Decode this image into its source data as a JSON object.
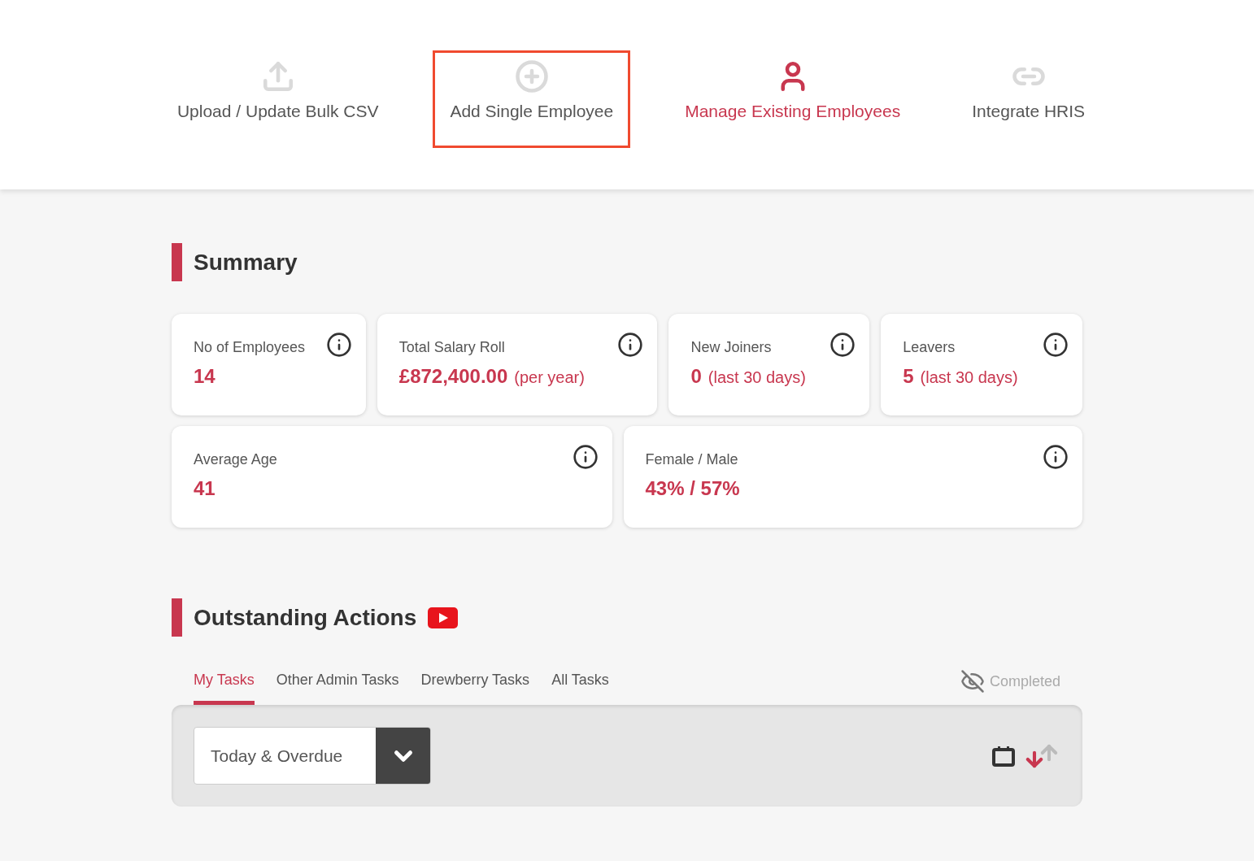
{
  "nav": [
    {
      "kind": "upload",
      "label": "Upload / Update Bulk CSV",
      "selected": false,
      "highlighted": false
    },
    {
      "kind": "add",
      "label": "Add Single Employee",
      "selected": false,
      "highlighted": true
    },
    {
      "kind": "person",
      "label": "Manage Existing Employees",
      "selected": true,
      "highlighted": false
    },
    {
      "kind": "link",
      "label": "Integrate HRIS",
      "selected": false,
      "highlighted": false
    }
  ],
  "summary": {
    "title": "Summary",
    "rows": [
      [
        {
          "label": "No of Employees",
          "value": "14"
        },
        {
          "label": "Total Salary Roll",
          "value": "£872,400.00",
          "suffix": "(per year)"
        },
        {
          "label": "New Joiners",
          "value": "0",
          "suffix": "(last 30 days)"
        },
        {
          "label": "Leavers",
          "value": "5",
          "suffix": "(last 30 days)"
        }
      ],
      [
        {
          "label": "Average Age",
          "value": "41"
        },
        {
          "label": "Female / Male",
          "value": "43% / 57%"
        }
      ]
    ]
  },
  "actions": {
    "title": "Outstanding Actions",
    "tabs": [
      {
        "label": "My Tasks",
        "selected": true
      },
      {
        "label": "Other Admin Tasks",
        "selected": false
      },
      {
        "label": "Drewberry Tasks",
        "selected": false
      },
      {
        "label": "All Tasks",
        "selected": false
      }
    ],
    "completed": {
      "label": "Completed",
      "shown": false
    },
    "filter": {
      "value": "Today & Overdue"
    },
    "sort": {
      "descending": true
    }
  }
}
